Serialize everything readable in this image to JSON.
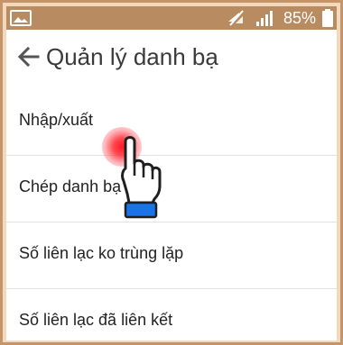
{
  "status_bar": {
    "battery_percent": "85%",
    "background_color": "#b88b61",
    "icons": [
      "image-icon",
      "mute-icon",
      "signal-icon",
      "battery-icon"
    ]
  },
  "toolbar": {
    "back_icon": "arrow-left-icon",
    "title": "Quản lý danh bạ"
  },
  "menu": {
    "items": [
      {
        "label": "Nhập/xuất"
      },
      {
        "label": "Chép danh bạ"
      },
      {
        "label": "Số liên lạc ko trùng lặp"
      },
      {
        "label": "Số liên lạc đã liên kết"
      }
    ]
  },
  "overlay": {
    "tap_indicator_color": "#ff1e28",
    "cursor_icon": "pointing-hand-icon",
    "cuff_color": "#1a73e8"
  },
  "colors": {
    "frame_border": "#c59469",
    "frame_inner": "#f2d8bd",
    "divider": "#e2e2e2"
  }
}
